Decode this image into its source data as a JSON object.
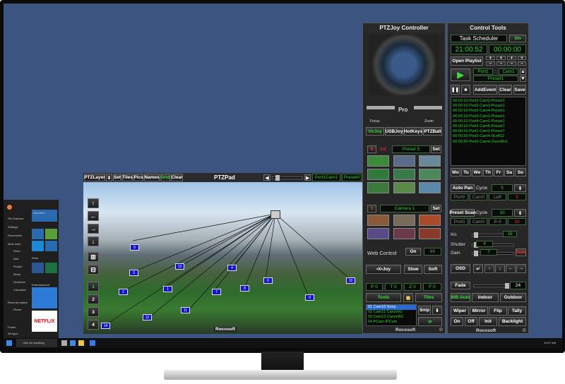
{
  "ptzjoy": {
    "title": "PTZJoy Controller",
    "pro": "Pro",
    "focus": "Focus",
    "zoom": "Zoom",
    "modes": [
      "VirJoy",
      "USBJoy",
      "HotKeys",
      "PTZBall"
    ],
    "preset_bar": {
      "num": "5",
      "label": "Init",
      "preset": "Preset 5",
      "set": "Set"
    },
    "camera_bar": {
      "num": "1",
      "camera": "Camera 1",
      "set": "Set"
    },
    "web_control": {
      "label": "Web Control",
      "on": "On",
      "port": "80"
    },
    "speed": [
      "•X•Joy",
      "Slow",
      "Soft"
    ],
    "pbtns": [
      "P 0",
      "T 0",
      "Z 0",
      "F 0"
    ],
    "tools": "Tools",
    "tiles": "Tiles",
    "cams": [
      "01 Cam10 Sony",
      "02 Cam11 CanonIG",
      "03 Cam12 CanonBC",
      "04 PCam IPCam"
    ],
    "snip": "Snip",
    "footer": "Rocosoft",
    "copy": "©"
  },
  "ptzpad": {
    "title": "PTZPad",
    "toolbar": [
      "PTZLayer",
      "⬇",
      "Set",
      "Tiles",
      "Pics",
      "Names",
      "Grid",
      "Clear"
    ],
    "sel": "Port1Cam1",
    "preset": "Preset0",
    "footer": "Rocosoft",
    "nums": [
      "1",
      "2",
      "3",
      "4"
    ],
    "markers": [
      "1",
      "2",
      "3",
      "4",
      "5",
      "6",
      "7",
      "8",
      "9",
      "10",
      "11",
      "12",
      "13",
      "14",
      "15",
      "16"
    ]
  },
  "control": {
    "title": "Control Tools",
    "scheduler": "Task Scheduler",
    "on": "On",
    "time1": "21:00:52",
    "time2": "00:00:00",
    "open_playlist": "Open Playlist",
    "port": "Port1",
    "cam": "Cam1",
    "preset": "Preset1",
    "add_event": "AddEvent",
    "clear": "Clear",
    "save": "Save",
    "log": [
      "00:00:10-Port2-Cam2-Preset1",
      "00:00:10-Port2-Cam3-Preset1",
      "00:00:10-Port2-Cam4-Preset1",
      "00:00:10-Port3-Cam1-Preset1",
      "00:00:10-Port4-Cam1-Preset1",
      "00:00:10-Port1-Cam5-Preset7",
      "00:00:10-Port1-Cam1-Preset7",
      "00:00:20-Port2-Cam4-0Left12",
      "00:00:30-Port2-Cam4-Zoom8n1"
    ],
    "days": [
      "Mo",
      "Tu",
      "We",
      "Th",
      "Fr",
      "Sa",
      "So"
    ],
    "auto_pan": "Auto Pan",
    "cycle": "Cycle",
    "cycle1": "5",
    "ap_row": [
      "Port0",
      "Cam0",
      "Left",
      "5"
    ],
    "preset_scan": "Preset Scan",
    "cycle2": "10",
    "ps_row": [
      "Port0",
      "Cam0",
      "P-0",
      "10"
    ],
    "iris": "Iris",
    "iris_val": "16",
    "shutter": "Shutter",
    "shutter_val": "4",
    "gain": "Gain",
    "gain_val": "7",
    "auto": "Auto",
    "osd": "OSD",
    "fade": "Fade",
    "fade_val": "24",
    "wb": [
      "WB:Auto",
      "Indoor",
      "Outdoor"
    ],
    "row1": [
      "Wiper",
      "Mirror",
      "Flip",
      "Tally"
    ],
    "row2": [
      "On",
      "Off",
      "Init",
      "Backlight"
    ],
    "footer": "Rocosoft",
    "copy": "©"
  },
  "startmenu": {
    "left": [
      "File Explorer",
      "Settings",
      "Documents",
      "Most used",
      "Word",
      "Mail",
      "People",
      "News",
      "OneDrive",
      "Calculator",
      "Recently added",
      "Pinner",
      "Power",
      "All Apps"
    ],
    "tiles": [
      "Welcome",
      "Work",
      "Entertainment",
      "NETFLIX"
    ]
  },
  "taskbar": {
    "search": "Ask me anything",
    "clock": "10:27 AM"
  },
  "colors": {
    "desktop": "#3b5580",
    "green": "#2fd32f",
    "red": "#ff3030"
  }
}
